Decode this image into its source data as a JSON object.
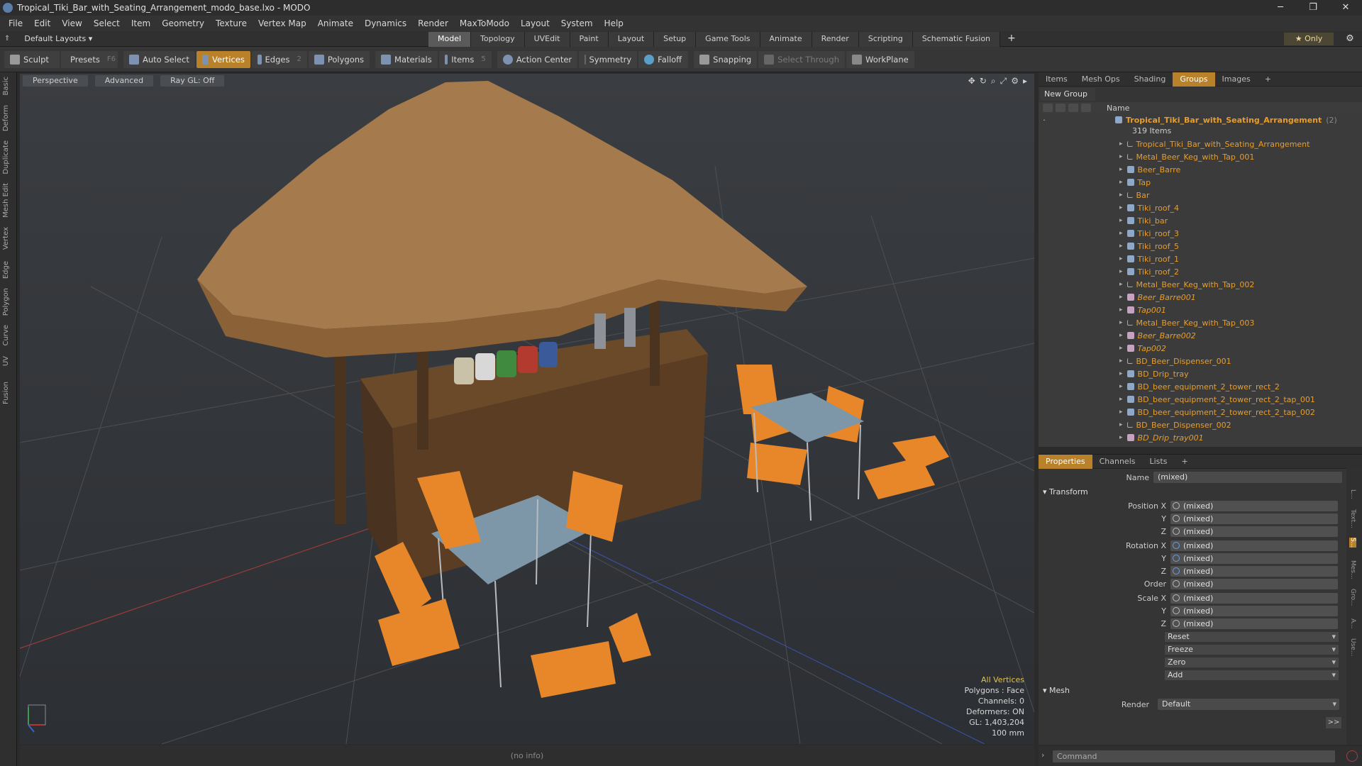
{
  "window": {
    "title": "Tropical_Tiki_Bar_with_Seating_Arrangement_modo_base.lxo - MODO",
    "minimize": "─",
    "maximize": "❐",
    "close": "✕"
  },
  "menu": [
    "File",
    "Edit",
    "View",
    "Select",
    "Item",
    "Geometry",
    "Texture",
    "Vertex Map",
    "Animate",
    "Dynamics",
    "Render",
    "MaxToModo",
    "Layout",
    "System",
    "Help"
  ],
  "layout": {
    "selector": "Default Layouts ▾",
    "tabs": [
      "Model",
      "Topology",
      "UVEdit",
      "Paint",
      "Layout",
      "Setup",
      "Game Tools",
      "Animate",
      "Render",
      "Scripting",
      "Schematic Fusion"
    ],
    "active_tab": "Model",
    "plus": "+",
    "only": "★  Only",
    "gear": "⚙"
  },
  "toolbar": {
    "sculpt": "Sculpt",
    "presets": "Presets",
    "presets_key": "F6",
    "auto_select": "Auto Select",
    "vertices": "Vertices",
    "vertices_key": "1",
    "edges": "Edges",
    "edges_key": "2",
    "polygons": "Polygons",
    "materials": "Materials",
    "items": "Items",
    "items_key": "5",
    "action_center": "Action Center",
    "symmetry": "Symmetry",
    "falloff": "Falloff",
    "snapping": "Snapping",
    "select_through": "Select Through",
    "workplane": "WorkPlane"
  },
  "left_tabs": [
    "Basic",
    "Deform",
    "Duplicate",
    "Mesh Edit",
    "Vertex",
    "Edge",
    "Polygon",
    "Curve",
    "UV",
    "Fusion"
  ],
  "viewport": {
    "perspective": "Perspective",
    "advanced": "Advanced",
    "raygl": "Ray GL: Off",
    "stats": {
      "all": "All Vertices",
      "polys": "Polygons : Face",
      "channels": "Channels: 0",
      "deformers": "Deformers: ON",
      "gl": "GL: 1,403,204",
      "size": "100 mm"
    },
    "status": "(no info)"
  },
  "items_panel": {
    "tabs": [
      "Items",
      "Mesh Ops",
      "Shading",
      "Groups",
      "Images",
      "+"
    ],
    "active_tab": "Groups",
    "new_group": "New Group",
    "name_header": "Name",
    "root": {
      "name": "Tropical_Tiki_Bar_with_Seating_Arrangement",
      "count": "(2)",
      "sub": "319 Items"
    },
    "items": [
      {
        "name": "Tropical_Tiki_Bar_with_Seating_Arrangement",
        "kind": "line",
        "italic": false
      },
      {
        "name": "Metal_Beer_Keg_with_Tap_001",
        "kind": "line",
        "italic": false
      },
      {
        "name": "Beer_Barre",
        "kind": "mesh",
        "italic": false
      },
      {
        "name": "Tap",
        "kind": "mesh",
        "italic": false
      },
      {
        "name": "Bar",
        "kind": "line",
        "italic": false
      },
      {
        "name": "Tiki_roof_4",
        "kind": "mesh",
        "italic": false
      },
      {
        "name": "Tiki_bar",
        "kind": "mesh",
        "italic": false
      },
      {
        "name": "Tiki_roof_3",
        "kind": "mesh",
        "italic": false
      },
      {
        "name": "Tiki_roof_5",
        "kind": "mesh",
        "italic": false
      },
      {
        "name": "Tiki_roof_1",
        "kind": "mesh",
        "italic": false
      },
      {
        "name": "Tiki_roof_2",
        "kind": "mesh",
        "italic": false
      },
      {
        "name": "Metal_Beer_Keg_with_Tap_002",
        "kind": "line",
        "italic": false
      },
      {
        "name": "Beer_Barre001",
        "kind": "pink",
        "italic": true
      },
      {
        "name": "Tap001",
        "kind": "pink",
        "italic": true
      },
      {
        "name": "Metal_Beer_Keg_with_Tap_003",
        "kind": "line",
        "italic": false
      },
      {
        "name": "Beer_Barre002",
        "kind": "pink",
        "italic": true
      },
      {
        "name": "Tap002",
        "kind": "pink",
        "italic": true
      },
      {
        "name": "BD_Beer_Dispenser_001",
        "kind": "line",
        "italic": false
      },
      {
        "name": "BD_Drip_tray",
        "kind": "mesh",
        "italic": false
      },
      {
        "name": "BD_beer_equipment_2_tower_rect_2",
        "kind": "mesh",
        "italic": false
      },
      {
        "name": "BD_beer_equipment_2_tower_rect_2_tap_001",
        "kind": "mesh",
        "italic": false
      },
      {
        "name": "BD_beer_equipment_2_tower_rect_2_tap_002",
        "kind": "mesh",
        "italic": false
      },
      {
        "name": "BD_Beer_Dispenser_002",
        "kind": "line",
        "italic": false
      },
      {
        "name": "BD_Drip_tray001",
        "kind": "pink",
        "italic": true
      }
    ]
  },
  "props_panel": {
    "tabs": [
      "Properties",
      "Channels",
      "Lists",
      "+"
    ],
    "active_tab": "Properties",
    "name_label": "Name",
    "name_value": "(mixed)",
    "transform": "Transform",
    "position_x": "Position X",
    "y": "Y",
    "z": "Z",
    "rotation_x": "Rotation X",
    "order": "Order",
    "scale_x": "Scale X",
    "mixed": "(mixed)",
    "reset": "Reset",
    "freeze": "Freeze",
    "zero": "Zero",
    "add": "Add",
    "mesh": "Mesh",
    "render_label": "Render",
    "render_value": "Default",
    "more": ">>"
  },
  "right_tabs": [
    "L...",
    "Text...",
    "S...",
    "Mes...",
    "Gro...",
    "A...",
    "Use..."
  ],
  "command": {
    "placeholder": "Command"
  },
  "colors": {
    "accent": "#b8812a",
    "item_name": "#e79d2d",
    "stats_highlight": "#e0c24e"
  }
}
